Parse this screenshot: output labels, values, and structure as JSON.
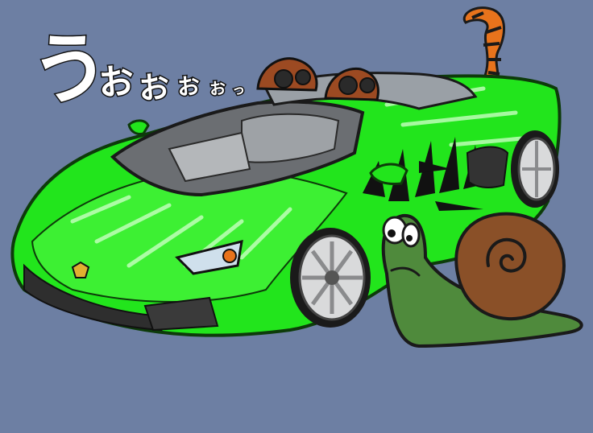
{
  "caption": {
    "big": "う",
    "o1": "お",
    "o2": "お",
    "o3": "お",
    "o4": "お",
    "tail": "っ"
  },
  "colors": {
    "background": "#6d7fa3",
    "car_body": "#22e51c",
    "car_outline": "#0d3b0a",
    "tiger_orange": "#e8731c",
    "snail_shell": "#8a5028",
    "snail_body": "#4f8a3c"
  },
  "scene": {
    "subjects": [
      "green-sports-car",
      "tiger-stripe-decal",
      "tiger-tail",
      "speakers",
      "snail"
    ]
  }
}
